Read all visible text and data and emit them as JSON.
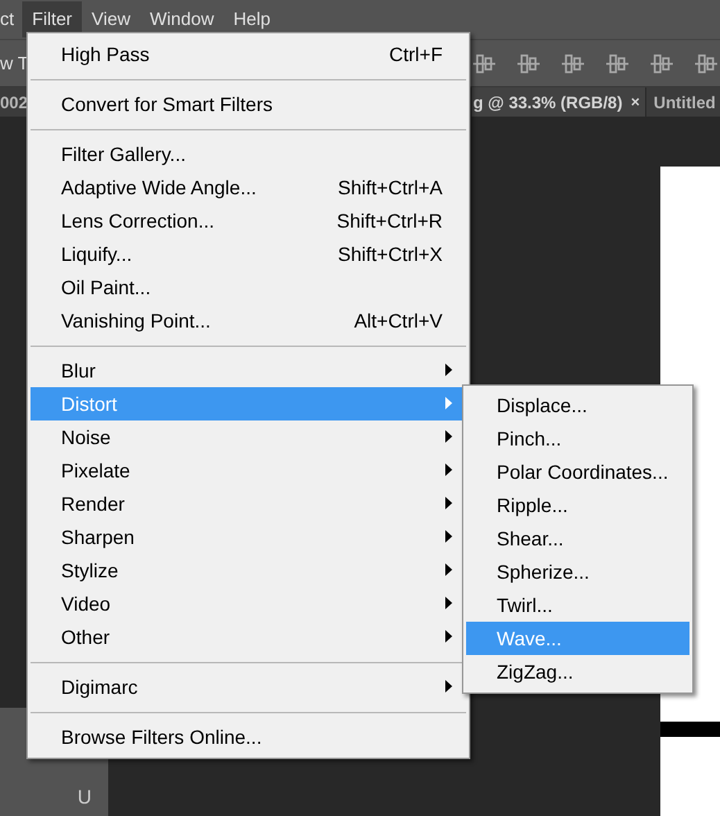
{
  "menubar": [
    {
      "label": "ct",
      "selected": false
    },
    {
      "label": "Filter",
      "selected": true
    },
    {
      "label": "View",
      "selected": false
    },
    {
      "label": "Window",
      "selected": false
    },
    {
      "label": "Help",
      "selected": false
    }
  ],
  "options_bar": {
    "tool_label": "w T"
  },
  "document_tabs": [
    {
      "label": "002",
      "selected": false
    },
    {
      "label": "g @ 33.3% (RGB/8)",
      "close": "×",
      "selected": true
    },
    {
      "label": "Untitled",
      "selected": false
    }
  ],
  "tools_panel": [
    {
      "shortcut": "U"
    }
  ],
  "filter_menu": [
    {
      "kind": "item",
      "label": "High Pass",
      "shortcut": "Ctrl+F",
      "submenu": false,
      "selected": false
    },
    {
      "kind": "separator"
    },
    {
      "kind": "item",
      "label": "Convert for Smart Filters",
      "submenu": false,
      "selected": false
    },
    {
      "kind": "separator"
    },
    {
      "kind": "item",
      "label": "Filter Gallery...",
      "submenu": false,
      "selected": false
    },
    {
      "kind": "item",
      "label": "Adaptive Wide Angle...",
      "shortcut": "Shift+Ctrl+A",
      "submenu": false,
      "selected": false
    },
    {
      "kind": "item",
      "label": "Lens Correction...",
      "shortcut": "Shift+Ctrl+R",
      "submenu": false,
      "selected": false
    },
    {
      "kind": "item",
      "label": "Liquify...",
      "shortcut": "Shift+Ctrl+X",
      "submenu": false,
      "selected": false
    },
    {
      "kind": "item",
      "label": "Oil Paint...",
      "submenu": false,
      "selected": false
    },
    {
      "kind": "item",
      "label": "Vanishing Point...",
      "shortcut": "Alt+Ctrl+V",
      "submenu": false,
      "selected": false
    },
    {
      "kind": "separator"
    },
    {
      "kind": "item",
      "label": "Blur",
      "submenu": true,
      "selected": false
    },
    {
      "kind": "item",
      "label": "Distort",
      "submenu": true,
      "selected": true
    },
    {
      "kind": "item",
      "label": "Noise",
      "submenu": true,
      "selected": false
    },
    {
      "kind": "item",
      "label": "Pixelate",
      "submenu": true,
      "selected": false
    },
    {
      "kind": "item",
      "label": "Render",
      "submenu": true,
      "selected": false
    },
    {
      "kind": "item",
      "label": "Sharpen",
      "submenu": true,
      "selected": false
    },
    {
      "kind": "item",
      "label": "Stylize",
      "submenu": true,
      "selected": false
    },
    {
      "kind": "item",
      "label": "Video",
      "submenu": true,
      "selected": false
    },
    {
      "kind": "item",
      "label": "Other",
      "submenu": true,
      "selected": false
    },
    {
      "kind": "separator"
    },
    {
      "kind": "item",
      "label": "Digimarc",
      "submenu": true,
      "selected": false
    },
    {
      "kind": "separator"
    },
    {
      "kind": "item",
      "label": "Browse Filters Online...",
      "submenu": false,
      "selected": false
    }
  ],
  "distort_submenu": [
    {
      "label": "Displace...",
      "selected": false
    },
    {
      "label": "Pinch...",
      "selected": false
    },
    {
      "label": "Polar Coordinates...",
      "selected": false
    },
    {
      "label": "Ripple...",
      "selected": false
    },
    {
      "label": "Shear...",
      "selected": false
    },
    {
      "label": "Spherize...",
      "selected": false
    },
    {
      "label": "Twirl...",
      "selected": false
    },
    {
      "label": "Wave...",
      "selected": true
    },
    {
      "label": "ZigZag...",
      "selected": false
    }
  ]
}
